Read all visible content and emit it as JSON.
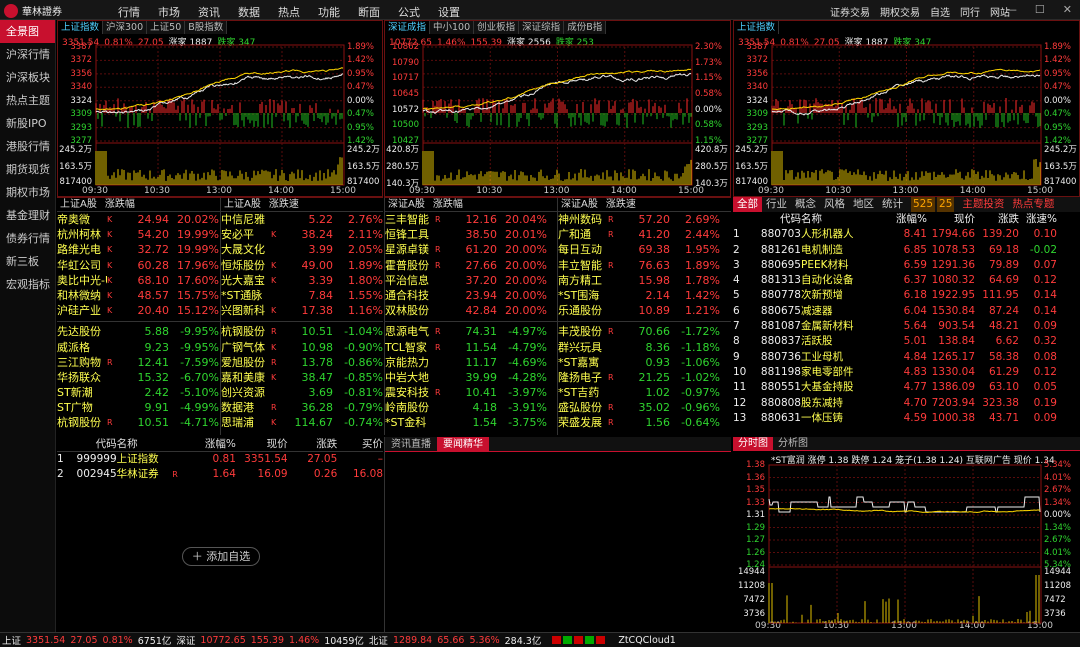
{
  "topbar": {
    "brand": "華林證券",
    "menu": [
      "行情",
      "市场",
      "资讯",
      "数据",
      "热点",
      "功能",
      "断面",
      "公式",
      "设置"
    ],
    "right_menu": [
      "证券交易",
      "期权交易",
      "自选",
      "同行",
      "网站"
    ]
  },
  "sidebar": [
    "全景图",
    "沪深行情",
    "沪深板块",
    "热点主题",
    "新股IPO",
    "港股行情",
    "期货现货",
    "期权市场",
    "基金理财",
    "债券行情",
    "新三板",
    "宏观指标"
  ],
  "charts": [
    {
      "tabs": [
        "上证指数",
        "沪深300",
        "上证50",
        "B股指数"
      ],
      "info": {
        "price": "3351.54",
        "pct": "0.81%",
        "chg": "27.05",
        "up": "涨家 1887",
        "down": "跌家 347"
      },
      "left_ticks": [
        "3387",
        "3372",
        "3356",
        "3340",
        "3324",
        "3309",
        "3293",
        "3277"
      ],
      "right_ticks": [
        "1.89%",
        "1.42%",
        "0.95%",
        "0.47%",
        "0.00%",
        "0.47%",
        "0.95%",
        "1.42%"
      ],
      "vol_left": [
        "245.2万",
        "163.5万",
        "817400"
      ],
      "vol_right": [
        "245.2万",
        "163.5万",
        "817400"
      ],
      "times": [
        "09:30",
        "10:30",
        "13:00",
        "14:00",
        "15:00"
      ]
    },
    {
      "tabs": [
        "深证成指",
        "中小100",
        "创业板指",
        "深证综指",
        "成份B指"
      ],
      "info": {
        "price": "10772.65",
        "pct": "1.46%",
        "chg": "155.39",
        "up": "涨家 2556",
        "down": "跌家 253"
      },
      "left_ticks": [
        "10862",
        "10790",
        "10717",
        "10645",
        "10572",
        "10500",
        "10427"
      ],
      "right_ticks": [
        "2.30%",
        "1.73%",
        "1.15%",
        "0.58%",
        "0.00%",
        "0.58%",
        "1.15%"
      ],
      "vol_left": [
        "420.8万",
        "280.5万",
        "140.3万"
      ],
      "vol_right": [
        "420.8万",
        "280.5万",
        "140.3万"
      ],
      "times": [
        "09:30",
        "10:30",
        "13:00",
        "14:00",
        "15:00"
      ]
    },
    {
      "tabs": [
        "上证指数"
      ],
      "info": {
        "price": "3351.54",
        "pct": "0.81%",
        "chg": "27.05",
        "up": "涨家 1887",
        "down": "跌家 347"
      },
      "left_ticks": [
        "3387",
        "3372",
        "3356",
        "3340",
        "3324",
        "3309",
        "3293",
        "3277"
      ],
      "right_ticks": [
        "1.89%",
        "1.42%",
        "0.95%",
        "0.47%",
        "0.00%",
        "0.47%",
        "0.95%",
        "1.42%"
      ],
      "vol_left": [
        "245.2万",
        "163.5万",
        "817400"
      ],
      "vol_right": [
        "245.2万",
        "163.5万",
        "817400"
      ],
      "times": [
        "09:30",
        "10:30",
        "13:00",
        "14:00",
        "15:00"
      ]
    }
  ],
  "rank_heads": [
    [
      "上证A股",
      "涨跌幅"
    ],
    [
      "上证A股",
      "涨跌速"
    ],
    [
      "深证A股",
      "涨跌幅"
    ],
    [
      "深证A股",
      "涨跌速"
    ]
  ],
  "rank_cols": [
    {
      "up": [
        [
          "帝奥微",
          "K",
          "24.94",
          "20.02%"
        ],
        [
          "杭州柯林",
          "K",
          "54.20",
          "19.99%"
        ],
        [
          "路维光电",
          "K",
          "32.72",
          "19.99%"
        ],
        [
          "华虹公司",
          "K",
          "60.28",
          "17.96%"
        ],
        [
          "奥比中光-UW",
          "K",
          "68.10",
          "17.60%"
        ],
        [
          "和林微纳",
          "K",
          "48.57",
          "15.75%"
        ],
        [
          "沪硅产业",
          "K",
          "20.40",
          "15.12%"
        ]
      ],
      "down": [
        [
          "先达股份",
          "",
          "5.88",
          "-9.95%"
        ],
        [
          "威派格",
          "",
          "9.23",
          "-9.95%"
        ],
        [
          "三江购物",
          "R",
          "12.41",
          "-7.59%"
        ],
        [
          "华扬联众",
          "",
          "15.32",
          "-6.70%"
        ],
        [
          "ST新潮",
          "",
          "2.42",
          "-5.10%"
        ],
        [
          "ST广物",
          "",
          "9.91",
          "-4.99%"
        ],
        [
          "杭钢股份",
          "R",
          "10.51",
          "-4.71%"
        ]
      ]
    },
    {
      "up": [
        [
          "中信尼雅",
          "",
          "5.22",
          "2.76%"
        ],
        [
          "安必平",
          "K",
          "38.24",
          "2.11%"
        ],
        [
          "大晟文化",
          "",
          "3.99",
          "2.05%"
        ],
        [
          "恒烁股份",
          "K",
          "49.00",
          "1.89%"
        ],
        [
          "光大嘉宝",
          "K",
          "3.39",
          "1.80%"
        ],
        [
          "*ST通脉",
          "",
          "7.84",
          "1.55%"
        ],
        [
          "兴图新科",
          "K",
          "17.38",
          "1.16%"
        ]
      ],
      "down": [
        [
          "杭钢股份",
          "R",
          "10.51",
          "-1.04%"
        ],
        [
          "广钢气体",
          "K",
          "10.98",
          "-0.90%"
        ],
        [
          "爱旭股份",
          "R",
          "13.78",
          "-0.86%"
        ],
        [
          "嘉和美康",
          "K",
          "38.47",
          "-0.85%"
        ],
        [
          "创兴资源",
          "",
          "3.69",
          "-0.81%"
        ],
        [
          "数据港",
          "R",
          "36.28",
          "-0.79%"
        ],
        [
          "思瑞浦",
          "K",
          "114.67",
          "-0.74%"
        ]
      ]
    },
    {
      "up": [
        [
          "三丰智能",
          "R",
          "12.16",
          "20.04%"
        ],
        [
          "恒锋工具",
          "",
          "38.50",
          "20.01%"
        ],
        [
          "星源卓镁",
          "R",
          "61.20",
          "20.00%"
        ],
        [
          "霍普股份",
          "R",
          "27.66",
          "20.00%"
        ],
        [
          "平治信息",
          "",
          "37.20",
          "20.00%"
        ],
        [
          "通合科技",
          "",
          "23.94",
          "20.00%"
        ],
        [
          "双林股份",
          "",
          "42.84",
          "20.00%"
        ]
      ],
      "down": [
        [
          "思源电气",
          "R",
          "74.31",
          "-4.97%"
        ],
        [
          "TCL智家",
          "R",
          "11.54",
          "-4.79%"
        ],
        [
          "京能热力",
          "",
          "11.17",
          "-4.69%"
        ],
        [
          "中岩大地",
          "",
          "39.99",
          "-4.28%"
        ],
        [
          "震安科技",
          "R",
          "10.41",
          "-3.97%"
        ],
        [
          "岭南股份",
          "",
          "4.18",
          "-3.91%"
        ],
        [
          "*ST金科",
          "",
          "1.54",
          "-3.75%"
        ]
      ]
    },
    {
      "up": [
        [
          "神州数码",
          "R",
          "57.20",
          "2.69%"
        ],
        [
          "广和通",
          "R",
          "41.20",
          "2.44%"
        ],
        [
          "每日互动",
          "",
          "69.38",
          "1.95%"
        ],
        [
          "丰立智能",
          "R",
          "76.63",
          "1.89%"
        ],
        [
          "南方精工",
          "",
          "15.98",
          "1.78%"
        ],
        [
          "*ST围海",
          "",
          "2.14",
          "1.42%"
        ],
        [
          "乐通股份",
          "",
          "10.89",
          "1.21%"
        ]
      ],
      "down": [
        [
          "丰茂股份",
          "R",
          "70.66",
          "-1.72%"
        ],
        [
          "群兴玩具",
          "",
          "8.36",
          "-1.18%"
        ],
        [
          "*ST嘉寓",
          "",
          "0.93",
          "-1.06%"
        ],
        [
          "隆扬电子",
          "R",
          "21.25",
          "-1.02%"
        ],
        [
          "*ST吉药",
          "",
          "1.02",
          "-0.97%"
        ],
        [
          "盛弘股份",
          "R",
          "35.02",
          "-0.96%"
        ],
        [
          "荣盛发展",
          "R",
          "1.56",
          "-0.64%"
        ]
      ]
    }
  ],
  "watchlist": {
    "head": [
      "",
      "代码",
      "名称",
      "",
      "涨幅%",
      "现价",
      "涨跌",
      "买价"
    ],
    "rows": [
      [
        "1",
        "999999",
        "上证指数",
        "",
        "0.81",
        "3351.54",
        "27.05",
        "–"
      ],
      [
        "2",
        "002945",
        "华林证券",
        "R",
        "1.64",
        "16.09",
        "0.26",
        "16.08"
      ]
    ],
    "add_button": "添加自选"
  },
  "news": {
    "tabs": [
      "资讯直播",
      "要闻精华"
    ]
  },
  "rtable": {
    "tabs": [
      "全部",
      "行业",
      "概念",
      "风格",
      "地区",
      "统计"
    ],
    "badge1": "525",
    "badge2": "25",
    "hot1": "主题投资",
    "hot2": "热点专题",
    "head": [
      "",
      "代码",
      "名称",
      "",
      "涨幅%",
      "现价",
      "涨跌",
      "涨速%"
    ],
    "rows": [
      [
        "1",
        "880703",
        "人形机器人",
        "8.41",
        "1794.66",
        "139.20",
        "0.10"
      ],
      [
        "2",
        "881261",
        "电机制造",
        "6.85",
        "1078.53",
        "69.18",
        "-0.02"
      ],
      [
        "3",
        "880695",
        "PEEK材料",
        "6.59",
        "1291.36",
        "79.89",
        "0.07"
      ],
      [
        "4",
        "881313",
        "自动化设备",
        "6.37",
        "1080.32",
        "64.69",
        "0.12"
      ],
      [
        "5",
        "880778",
        "次新预增",
        "6.18",
        "1922.95",
        "111.95",
        "0.14"
      ],
      [
        "6",
        "880675",
        "减速器",
        "6.04",
        "1530.84",
        "87.24",
        "0.14"
      ],
      [
        "7",
        "881087",
        "金属新材料",
        "5.64",
        "903.54",
        "48.21",
        "0.09"
      ],
      [
        "8",
        "880837",
        "活跃股",
        "5.01",
        "138.84",
        "6.62",
        "0.32"
      ],
      [
        "9",
        "880736",
        "工业母机",
        "4.84",
        "1265.17",
        "58.38",
        "0.08"
      ],
      [
        "10",
        "881198",
        "家电零部件",
        "4.83",
        "1330.04",
        "61.29",
        "0.12"
      ],
      [
        "11",
        "880551",
        "大基金持股",
        "4.77",
        "1386.09",
        "63.10",
        "0.05"
      ],
      [
        "12",
        "880808",
        "股东减持",
        "4.70",
        "7203.94",
        "323.38",
        "0.19"
      ],
      [
        "13",
        "880631",
        "一体压铸",
        "4.59",
        "1000.38",
        "43.71",
        "0.09"
      ]
    ]
  },
  "mini": {
    "tabs": [
      "分时图",
      "分析图"
    ],
    "info": "*ST富润  涨停 1.38 跌停 1.24 笼子(1.38 1.24) 互联网广告 现价 1.34",
    "left_ticks": [
      "1.38",
      "1.36",
      "1.35",
      "1.33",
      "1.31",
      "1.29",
      "1.27",
      "1.26",
      "1.24"
    ],
    "right_ticks": [
      "5.34%",
      "4.01%",
      "2.67%",
      "1.34%",
      "0.00%",
      "1.34%",
      "2.67%",
      "4.01%",
      "5.34%"
    ],
    "vol_left": [
      "14944",
      "11208",
      "7472",
      "3736"
    ],
    "vol_right": [
      "14944",
      "11208",
      "7472",
      "3736"
    ],
    "times": [
      "09:30",
      "10:30",
      "13:00",
      "14:00",
      "15:00"
    ]
  },
  "status": {
    "sh_label": "上证",
    "sh_price": "3351.54",
    "sh_chg": "27.05",
    "sh_pct": "0.81%",
    "sh_amt": "6751亿",
    "sz_label": "深证",
    "sz_price": "10772.65",
    "sz_chg": "155.39",
    "sz_pct": "1.46%",
    "sz_amt": "10459亿",
    "bz_label": "北证",
    "bz_price": "1289.84",
    "bz_chg": "65.66",
    "bz_pct": "5.36%",
    "bz_amt": "284.3亿",
    "server": "ZtCQCloud1"
  }
}
